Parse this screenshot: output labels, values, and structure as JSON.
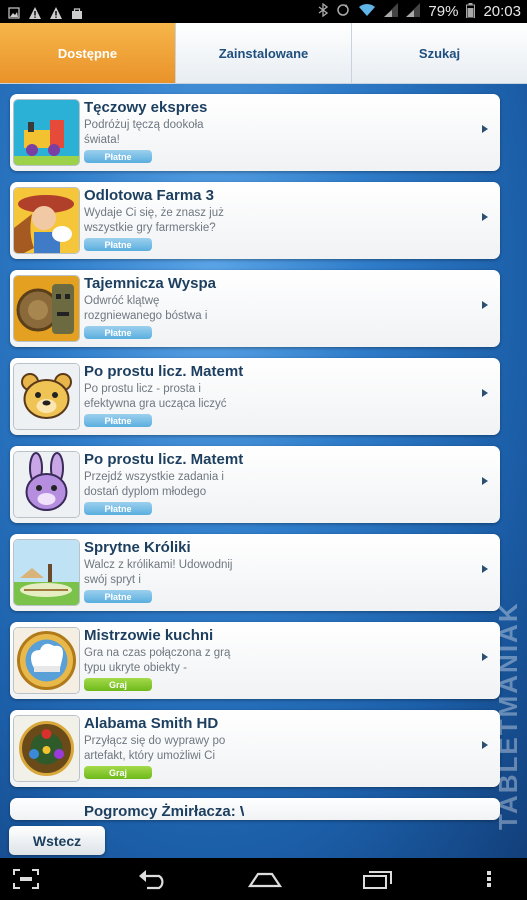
{
  "status_bar": {
    "battery": "79%",
    "time": "20:03",
    "icons": [
      "image-icon",
      "warning-icon",
      "warning-icon",
      "bag-icon",
      "bluetooth-icon",
      "sync-icon",
      "wifi-icon",
      "signal-icon",
      "signal-icon"
    ]
  },
  "tabs": [
    {
      "label": "Dostępne",
      "active": true
    },
    {
      "label": "Zainstalowane",
      "active": false
    },
    {
      "label": "Szukaj",
      "active": false
    }
  ],
  "items": [
    {
      "title": "Tęczowy ekspres",
      "desc": "Podróżuj tęczą dookoła świata!",
      "badge": "Płatne",
      "badge_type": "paid",
      "icon": "train-icon"
    },
    {
      "title": "Odlotowa Farma 3",
      "desc": "Wydaje Ci się, że znasz już wszystkie gry farmerskie?",
      "badge": "Płatne",
      "badge_type": "paid",
      "icon": "farmer-girl-icon"
    },
    {
      "title": "Tajemnicza Wyspa",
      "desc": "Odwróć klątwę rozgniewanego bóstwa i",
      "badge": "Płatne",
      "badge_type": "paid",
      "icon": "tiki-icon"
    },
    {
      "title": "Po prostu licz. Matemt",
      "desc": "Po prostu licz - prosta i efektywna gra ucząca liczyć",
      "badge": "Płatne",
      "badge_type": "paid",
      "icon": "bear-icon"
    },
    {
      "title": "Po prostu licz. Matemt",
      "desc": "Przejdź wszystkie zadania i dostań dyplom młodego",
      "badge": "Płatne",
      "badge_type": "paid",
      "icon": "rabbit-icon"
    },
    {
      "title": "Sprytne Króliki",
      "desc": "Walcz z królikami! Udowodnij swój spryt i",
      "badge": "Płatne",
      "badge_type": "paid",
      "icon": "clever-rabbits-icon"
    },
    {
      "title": "Mistrzowie kuchni",
      "desc": "Gra na czas połączona z grą typu ukryte obiekty -",
      "badge": "Graj",
      "badge_type": "play",
      "icon": "chef-hat-icon"
    },
    {
      "title": "Alabama Smith HD",
      "desc": "Przyłącz się do wyprawy po artefakt, który umożliwi Ci",
      "badge": "Graj",
      "badge_type": "play",
      "icon": "gem-amulet-icon"
    },
    {
      "title": "Pogromcy Żmirłacza: W",
      "desc": "",
      "badge": "",
      "badge_type": "",
      "icon": ""
    }
  ],
  "back_button": "Wstecz",
  "watermark": "TABLETMANIAK",
  "navbar": {
    "icons": [
      "scan-icon",
      "back-icon",
      "home-icon",
      "recent-apps-icon",
      "menu-icon"
    ]
  },
  "colors": {
    "accent": "#e9922a",
    "title": "#1d3f5f",
    "paid_badge": "#5aaedf",
    "play_badge": "#6eb91a"
  }
}
